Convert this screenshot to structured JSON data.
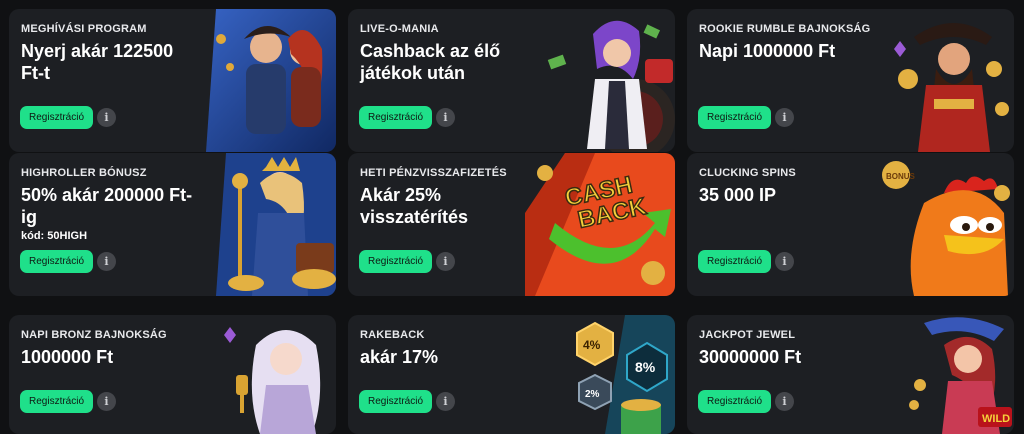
{
  "cards": [
    {
      "eyebrow": "MEGHÍVÁSI PROGRAM",
      "title": "Nyerj akár 122500 Ft-t",
      "button": "Regisztráció",
      "info": "i",
      "art": "pirates-illustration"
    },
    {
      "eyebrow": "LIVE-O-MANIA",
      "title": "Cashback az élő játékok után",
      "button": "Regisztráció",
      "info": "i",
      "art": "croupier-illustration"
    },
    {
      "eyebrow": "ROOKIE RUMBLE BAJNOKSÁG",
      "title": "Napi 1000000 Ft",
      "button": "Regisztráció",
      "info": "i",
      "art": "pirate-captain-illustration"
    },
    {
      "eyebrow": "HIGHROLLER BÓNUSZ",
      "title": "50% akár 200000 Ft-ig",
      "code": "kód: 50HIGH",
      "button": "Regisztráció",
      "info": "i",
      "art": "queen-treasure-illustration"
    },
    {
      "eyebrow": "HETI PÉNZVISSZAFIZETÉS",
      "title": "Akár 25% visszatérítés",
      "button": "Regisztráció",
      "info": "i",
      "art": "cashback-arrow-illustration",
      "art_text": "CASH BACK"
    },
    {
      "eyebrow": "CLUCKING SPINS",
      "title": "35 000 IP",
      "button": "Regisztráció",
      "info": "i",
      "art": "rooster-illustration",
      "art_text": "BONUS"
    },
    {
      "eyebrow": "NAPI BRONZ BAJNOKSÁG",
      "title": "1000000 Ft",
      "button": "Regisztráció",
      "info": "i",
      "art": "elf-girl-illustration"
    },
    {
      "eyebrow": "RAKEBACK",
      "title": "akár 17%",
      "button": "Regisztráció",
      "info": "i",
      "art": "rakeback-badges-illustration",
      "badges": [
        "4%",
        "8%",
        "2%"
      ]
    },
    {
      "eyebrow": "JACKPOT JEWEL",
      "title": "30000000 Ft",
      "button": "Regisztráció",
      "info": "i",
      "art": "jewel-girl-illustration",
      "art_text": "WILD"
    }
  ],
  "colors": {
    "background": "#101113",
    "card": "#1d1f23",
    "accent": "#1fe08a"
  }
}
